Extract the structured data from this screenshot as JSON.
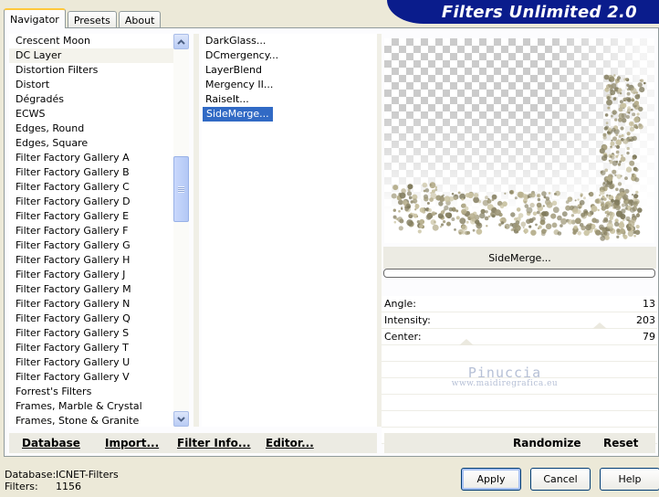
{
  "tabs": [
    "Navigator",
    "Presets",
    "About"
  ],
  "banner_title": "Filters Unlimited 2.0",
  "categories": [
    "Crescent Moon",
    "DC Layer",
    "Distortion Filters",
    "Distort",
    "Dégradés",
    "ECWS",
    "Edges, Round",
    "Edges, Square",
    "Filter Factory Gallery A",
    "Filter Factory Gallery B",
    "Filter Factory Gallery C",
    "Filter Factory Gallery D",
    "Filter Factory Gallery E",
    "Filter Factory Gallery F",
    "Filter Factory Gallery G",
    "Filter Factory Gallery H",
    "Filter Factory Gallery J",
    "Filter Factory Gallery M",
    "Filter Factory Gallery N",
    "Filter Factory Gallery Q",
    "Filter Factory Gallery S",
    "Filter Factory Gallery T",
    "Filter Factory Gallery U",
    "Filter Factory Gallery V",
    "Forrest's Filters",
    "Frames, Marble & Crystal",
    "Frames, Stone & Granite"
  ],
  "selected_category": "DC Layer",
  "filters": [
    "DarkGlass...",
    "DCmergency...",
    "LayerBlend",
    "Mergency II...",
    "RaiseIt...",
    "SideMerge..."
  ],
  "selected_filter": "SideMerge...",
  "current_filter_label": "SideMerge...",
  "params": [
    {
      "label": "Angle:",
      "value": "13"
    },
    {
      "label": "Intensity:",
      "value": "203"
    },
    {
      "label": "Center:",
      "value": "79"
    }
  ],
  "watermark": {
    "line1": "Pinuccia",
    "line2": "www.maidiregrafica.eu"
  },
  "toolbar_left": [
    "Database",
    "Import...",
    "Filter Info...",
    "Editor..."
  ],
  "toolbar_right": [
    "Randomize",
    "Reset"
  ],
  "status": {
    "database_label": "Database:",
    "database_value": "ICNET-Filters",
    "filters_label": "Filters:",
    "filters_value": "1156"
  },
  "dialog_buttons": [
    "Apply",
    "Cancel",
    "Help"
  ]
}
